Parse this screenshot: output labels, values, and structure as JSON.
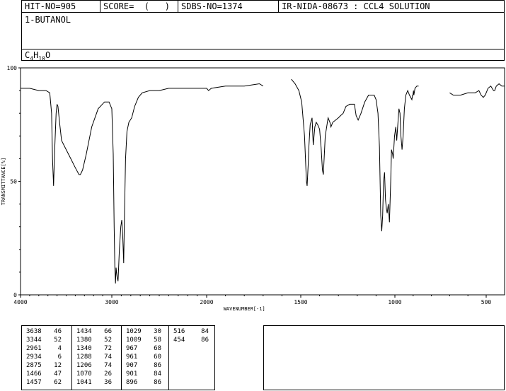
{
  "header": {
    "hit_no": "HIT-NO=905",
    "score": "SCORE=  (   )",
    "sdbs_no": "SDBS-NO=1374",
    "ir_info": "IR-NIDA-08673 : CCL4 SOLUTION"
  },
  "compound": {
    "name": "1-BUTANOL",
    "formula_parts": [
      "C",
      "4",
      "H",
      "10",
      "O"
    ]
  },
  "chart_data": {
    "type": "line",
    "xlabel": "WAVENUMBER[-1]",
    "ylabel": "TRANSMITTANCE[%]",
    "xlim": [
      4000,
      400
    ],
    "ylim": [
      0,
      100
    ],
    "x_ticks": [
      4000,
      3000,
      2000,
      1500,
      1000,
      500
    ],
    "x_tick_labels": [
      "4000",
      "3000",
      "2000",
      "1500",
      "1000",
      "500"
    ],
    "y_ticks": [
      0,
      50,
      100
    ],
    "y_tick_labels": [
      "0",
      "50",
      "100"
    ],
    "segments": [
      [
        [
          4000,
          91
        ],
        [
          3900,
          91
        ],
        [
          3800,
          90
        ],
        [
          3720,
          90
        ],
        [
          3680,
          89
        ],
        [
          3660,
          80
        ],
        [
          3650,
          60
        ],
        [
          3638,
          48
        ],
        [
          3625,
          65
        ],
        [
          3610,
          80
        ],
        [
          3600,
          84
        ],
        [
          3590,
          83
        ],
        [
          3570,
          75
        ],
        [
          3550,
          68
        ],
        [
          3500,
          64
        ],
        [
          3450,
          60
        ],
        [
          3400,
          56
        ],
        [
          3360,
          53
        ],
        [
          3344,
          53
        ],
        [
          3320,
          55
        ],
        [
          3280,
          62
        ],
        [
          3220,
          74
        ],
        [
          3150,
          82
        ],
        [
          3080,
          85
        ],
        [
          3030,
          85
        ],
        [
          3000,
          82
        ],
        [
          2985,
          62
        ],
        [
          2975,
          30
        ],
        [
          2968,
          12
        ],
        [
          2961,
          5
        ],
        [
          2955,
          12
        ],
        [
          2945,
          8
        ],
        [
          2934,
          6
        ],
        [
          2920,
          20
        ],
        [
          2905,
          30
        ],
        [
          2895,
          33
        ],
        [
          2885,
          26
        ],
        [
          2875,
          14
        ],
        [
          2868,
          32
        ],
        [
          2855,
          60
        ],
        [
          2840,
          72
        ],
        [
          2820,
          76
        ],
        [
          2790,
          78
        ],
        [
          2760,
          83
        ],
        [
          2720,
          87
        ],
        [
          2680,
          89
        ],
        [
          2600,
          90
        ],
        [
          2500,
          90
        ],
        [
          2400,
          91
        ],
        [
          2300,
          91
        ],
        [
          2200,
          91
        ],
        [
          2100,
          91
        ],
        [
          2000,
          91
        ],
        [
          1990,
          90
        ],
        [
          1975,
          91
        ],
        [
          1900,
          92
        ],
        [
          1800,
          92
        ],
        [
          1720,
          93
        ],
        [
          1700,
          92
        ]
      ],
      [
        [
          1550,
          95
        ],
        [
          1530,
          93
        ],
        [
          1510,
          90
        ],
        [
          1495,
          85
        ],
        [
          1480,
          70
        ],
        [
          1470,
          50
        ],
        [
          1466,
          48
        ],
        [
          1460,
          58
        ],
        [
          1457,
          65
        ],
        [
          1450,
          75
        ],
        [
          1440,
          78
        ],
        [
          1434,
          66
        ],
        [
          1425,
          74
        ],
        [
          1418,
          76
        ],
        [
          1410,
          75
        ],
        [
          1400,
          73
        ],
        [
          1392,
          65
        ],
        [
          1385,
          55
        ],
        [
          1380,
          53
        ],
        [
          1370,
          70
        ],
        [
          1355,
          78
        ],
        [
          1345,
          76
        ],
        [
          1340,
          74
        ],
        [
          1330,
          76
        ],
        [
          1300,
          78
        ],
        [
          1288,
          79
        ],
        [
          1275,
          80
        ],
        [
          1260,
          83
        ],
        [
          1240,
          84
        ],
        [
          1215,
          84
        ],
        [
          1206,
          79
        ],
        [
          1195,
          77
        ],
        [
          1180,
          80
        ],
        [
          1160,
          85
        ],
        [
          1140,
          88
        ],
        [
          1110,
          88
        ],
        [
          1100,
          86
        ],
        [
          1090,
          80
        ],
        [
          1082,
          65
        ],
        [
          1075,
          35
        ],
        [
          1070,
          28
        ],
        [
          1065,
          35
        ],
        [
          1060,
          50
        ],
        [
          1055,
          54
        ],
        [
          1050,
          42
        ],
        [
          1045,
          38
        ],
        [
          1041,
          36
        ],
        [
          1035,
          40
        ],
        [
          1029,
          32
        ],
        [
          1022,
          50
        ],
        [
          1018,
          64
        ],
        [
          1012,
          62
        ],
        [
          1009,
          60
        ],
        [
          1002,
          70
        ],
        [
          995,
          74
        ],
        [
          990,
          68
        ],
        [
          985,
          74
        ],
        [
          978,
          82
        ],
        [
          972,
          80
        ],
        [
          967,
          70
        ],
        [
          961,
          64
        ],
        [
          955,
          70
        ],
        [
          948,
          82
        ],
        [
          940,
          88
        ],
        [
          930,
          90
        ],
        [
          920,
          88
        ],
        [
          907,
          86
        ],
        [
          903,
          88
        ],
        [
          901,
          88
        ],
        [
          898,
          90
        ],
        [
          896,
          88
        ],
        [
          890,
          91
        ],
        [
          880,
          92
        ],
        [
          870,
          92
        ]
      ],
      [
        [
          700,
          89
        ],
        [
          680,
          88
        ],
        [
          640,
          88
        ],
        [
          600,
          89
        ],
        [
          560,
          89
        ],
        [
          540,
          90
        ],
        [
          528,
          88
        ],
        [
          516,
          87
        ],
        [
          505,
          88
        ],
        [
          490,
          91
        ],
        [
          475,
          92
        ],
        [
          460,
          90
        ],
        [
          454,
          90
        ],
        [
          445,
          92
        ],
        [
          430,
          93
        ],
        [
          415,
          92
        ],
        [
          400,
          92
        ]
      ]
    ]
  },
  "peak_table": {
    "columns": [
      [
        [
          "3638",
          "46"
        ],
        [
          "3344",
          "52"
        ],
        [
          "2961",
          "4"
        ],
        [
          "2934",
          "6"
        ],
        [
          "2875",
          "12"
        ],
        [
          "1466",
          "47"
        ],
        [
          "1457",
          "62"
        ]
      ],
      [
        [
          "1434",
          "66"
        ],
        [
          "1380",
          "52"
        ],
        [
          "1340",
          "72"
        ],
        [
          "1288",
          "74"
        ],
        [
          "1206",
          "74"
        ],
        [
          "1070",
          "26"
        ],
        [
          "1041",
          "36"
        ]
      ],
      [
        [
          "1029",
          "30"
        ],
        [
          "1009",
          "58"
        ],
        [
          "967",
          "68"
        ],
        [
          "961",
          "60"
        ],
        [
          "907",
          "86"
        ],
        [
          "901",
          "84"
        ],
        [
          "896",
          "86"
        ]
      ],
      [
        [
          "516",
          "84"
        ],
        [
          "454",
          "86"
        ]
      ]
    ]
  }
}
